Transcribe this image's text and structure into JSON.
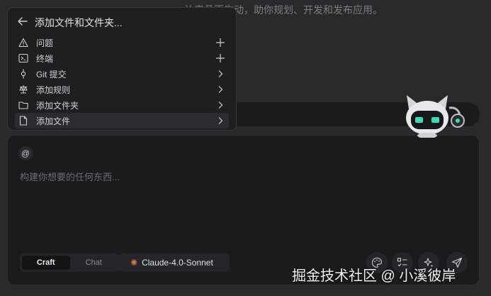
{
  "background": {
    "text": "让产品更生动，助你规划、开发和发布应用。"
  },
  "popup": {
    "title": "添加文件和文件夹...",
    "items": [
      {
        "label": "问题",
        "icon": "warning-icon",
        "action": "plus-icon"
      },
      {
        "label": "终端",
        "icon": "terminal-icon",
        "action": "plus-icon"
      },
      {
        "label": "Git 提交",
        "icon": "git-commit-icon",
        "action": "chevron-right-icon"
      },
      {
        "label": "添加规则",
        "icon": "scale-icon",
        "action": "chevron-right-icon"
      },
      {
        "label": "添加文件夹",
        "icon": "folder-icon",
        "action": "chevron-right-icon"
      },
      {
        "label": "添加文件",
        "icon": "file-icon",
        "action": "chevron-right-icon"
      }
    ]
  },
  "composer": {
    "at_symbol": "@",
    "placeholder": "构建你想要的任何东西...",
    "modes": [
      "Craft",
      "Chat"
    ],
    "active_mode": "Craft",
    "model": "Claude-4.0-Sonnet",
    "tools": [
      "palette-icon",
      "checklist-icon",
      "sparkle-icon",
      "send-icon"
    ]
  },
  "watermark": "掘金技术社区 @ 小溪彼岸",
  "colors": {
    "accent": "#d9774c",
    "robot_eye": "#33e0b5"
  }
}
